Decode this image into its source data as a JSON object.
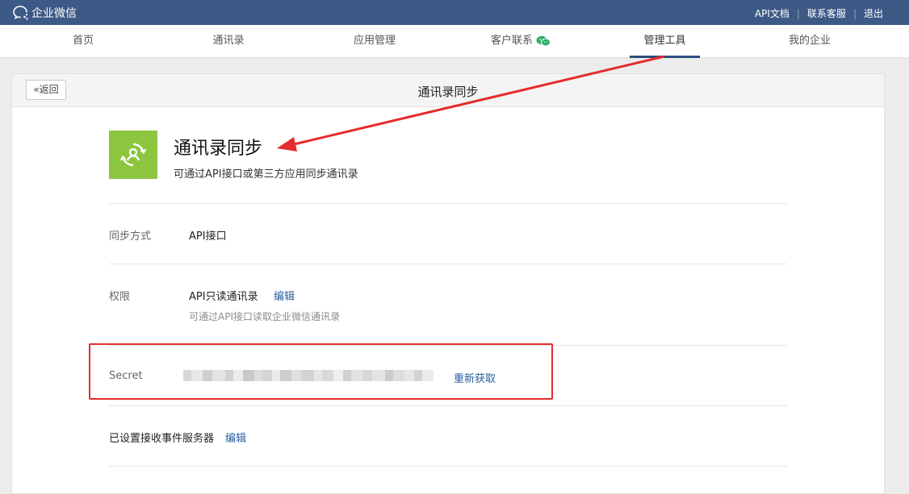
{
  "topbar": {
    "brand": "企业微信",
    "links": [
      "API文档",
      "联系客服",
      "退出"
    ]
  },
  "nav": {
    "items": [
      "首页",
      "通讯录",
      "应用管理",
      "客户联系",
      "管理工具",
      "我的企业"
    ],
    "active": "管理工具"
  },
  "header": {
    "back_label": "返回",
    "title": "通讯录同步"
  },
  "app": {
    "name": "通讯录同步",
    "description": "可通过API接口或第三方应用同步通讯录"
  },
  "rows": {
    "sync_label": "同步方式",
    "sync_value": "API接口",
    "permission_label": "权限",
    "permission_value": "API只读通讯录",
    "permission_edit": "编辑",
    "permission_desc": "可通过API接口读取企业微信通讯录",
    "secret_label": "Secret",
    "secret_action": "重新获取",
    "server_label": "已设置接收事件服务器",
    "server_edit": "编辑"
  },
  "colors": {
    "topbar": "#3d5a86",
    "accent_link": "#2a5e9c",
    "app_icon_bg": "#8cc63f",
    "annotation_red": "#e52b2b"
  }
}
